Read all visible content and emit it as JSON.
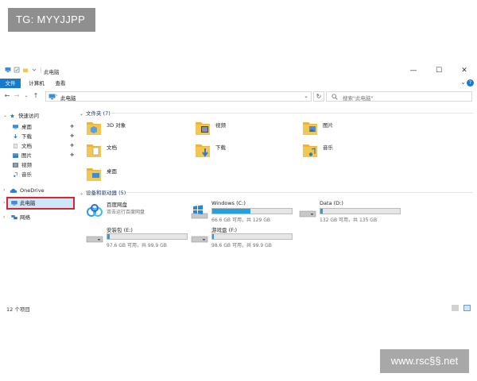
{
  "watermarks": {
    "top": "TG: MYYJJPP",
    "bottom": "www.rsc§§.net"
  },
  "window": {
    "title": "此电脑",
    "controls": {
      "minimize": "—",
      "maximize": "☐",
      "close": "✕"
    }
  },
  "ribbon": {
    "tabs": [
      {
        "label": "文件",
        "active": true
      },
      {
        "label": "计算机"
      },
      {
        "label": "查看"
      }
    ],
    "help": "?"
  },
  "address": {
    "path": "此电脑",
    "search_placeholder": "搜索\"此电脑\""
  },
  "sidebar": {
    "quick_access": "快速访问",
    "items": [
      "桌面",
      "下载",
      "文档",
      "图片",
      "视频",
      "音乐"
    ],
    "onedrive": "OneDrive",
    "this_pc": "此电脑",
    "network": "网络"
  },
  "content": {
    "folders_header": "文件夹 (7)",
    "folders": [
      "3D 对象",
      "视频",
      "图片",
      "文档",
      "下载",
      "音乐",
      "桌面"
    ],
    "devices_header": "设备和驱动器 (5)",
    "drives": [
      {
        "name": "百度网盘",
        "free": "双击运行百度网盘",
        "fill": null
      },
      {
        "name": "Windows (C:)",
        "free": "66.6 GB 可用，共 129 GB",
        "fill": 0.48
      },
      {
        "name": "Data (D:)",
        "free": "132 GB 可用，共 135 GB",
        "fill": 0.03
      },
      {
        "name": "安装包 (E:)",
        "free": "97.6 GB 可用，共 99.9 GB",
        "fill": 0.03
      },
      {
        "name": "游戏盘 (F:)",
        "free": "98.6 GB 可用，共 99.9 GB",
        "fill": 0.02
      }
    ]
  },
  "status": {
    "count": "12 个项目"
  },
  "colors": {
    "accent": "#1979ca",
    "drive_fill": "#26a0da",
    "highlight": "#d6262b",
    "folder": "#f3c552"
  }
}
